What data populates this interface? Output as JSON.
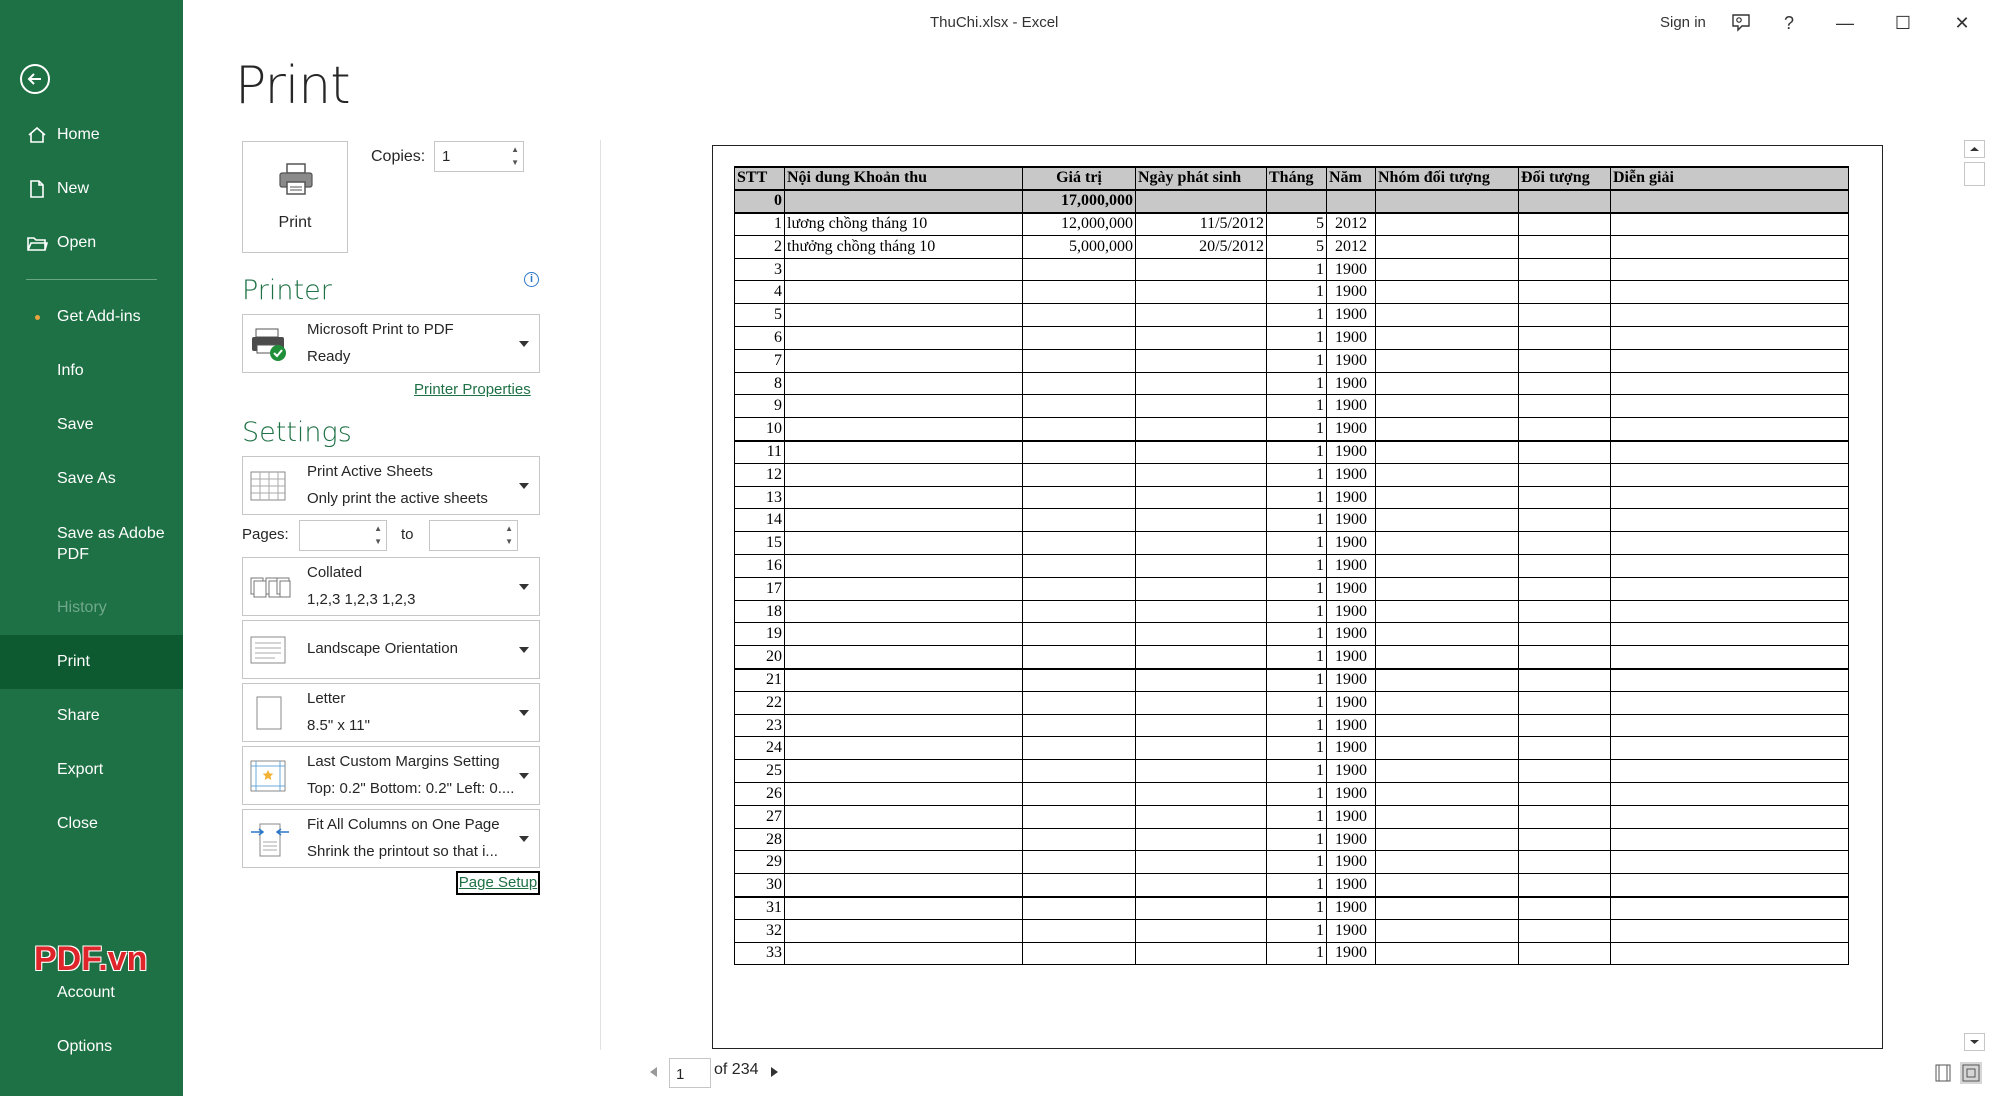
{
  "window": {
    "title": "ThuChi.xlsx  -  Excel",
    "sign_in": "Sign in",
    "help": "?",
    "minimize": "—",
    "maximize": "☐",
    "close": "✕"
  },
  "sidebar": {
    "items": [
      {
        "label": "Home",
        "icon": "home-icon"
      },
      {
        "label": "New",
        "icon": "new-document-icon"
      },
      {
        "label": "Open",
        "icon": "open-folder-icon"
      },
      {
        "label": "Get Add-ins"
      },
      {
        "label": "Info"
      },
      {
        "label": "Save"
      },
      {
        "label": "Save As"
      },
      {
        "label": "Save as Adobe PDF"
      },
      {
        "label": "History"
      },
      {
        "label": "Print"
      },
      {
        "label": "Share"
      },
      {
        "label": "Export"
      },
      {
        "label": "Close"
      },
      {
        "label": "Account"
      },
      {
        "label": "Options"
      }
    ],
    "watermark": "PDF.vn"
  },
  "print": {
    "title": "Print",
    "button_label": "Print",
    "copies_label": "Copies:",
    "copies_value": "1",
    "printer_heading": "Printer",
    "printer_name": "Microsoft Print to PDF",
    "printer_status": "Ready",
    "printer_properties": "Printer Properties",
    "settings_heading": "Settings",
    "settings": [
      {
        "line1": "Print Active Sheets",
        "line2": "Only print the active sheets"
      },
      {
        "line1": "Collated",
        "line2": "1,2,3    1,2,3    1,2,3"
      },
      {
        "line1": "Landscape Orientation",
        "line2": ""
      },
      {
        "line1": "Letter",
        "line2": "8.5\" x 11\""
      },
      {
        "line1": "Last Custom Margins Setting",
        "line2": "Top: 0.2\" Bottom: 0.2\" Left: 0...."
      },
      {
        "line1": "Fit All Columns on One Page",
        "line2": "Shrink the printout so that i..."
      }
    ],
    "pages_label": "Pages:",
    "to_label": "to",
    "page_setup": "Page Setup"
  },
  "preview": {
    "headers": [
      "STT",
      "Nội dung Khoản thu",
      "Giá trị",
      "Ngày phát sinh",
      "Tháng",
      "Năm",
      "Nhóm đối tượng",
      "Đối tượng",
      "Diễn giải"
    ],
    "total_row": [
      "0",
      "",
      "17,000,000",
      "",
      "",
      "",
      "",
      "",
      ""
    ],
    "rows": [
      [
        "1",
        "lương chồng tháng 10",
        "12,000,000",
        "11/5/2012",
        "5",
        "2012",
        "",
        "",
        ""
      ],
      [
        "2",
        "thưởng chồng tháng 10",
        "5,000,000",
        "20/5/2012",
        "5",
        "2012",
        "",
        "",
        ""
      ],
      [
        "3",
        "",
        "",
        "",
        "1",
        "1900",
        "",
        "",
        ""
      ],
      [
        "4",
        "",
        "",
        "",
        "1",
        "1900",
        "",
        "",
        ""
      ],
      [
        "5",
        "",
        "",
        "",
        "1",
        "1900",
        "",
        "",
        ""
      ],
      [
        "6",
        "",
        "",
        "",
        "1",
        "1900",
        "",
        "",
        ""
      ],
      [
        "7",
        "",
        "",
        "",
        "1",
        "1900",
        "",
        "",
        ""
      ],
      [
        "8",
        "",
        "",
        "",
        "1",
        "1900",
        "",
        "",
        ""
      ],
      [
        "9",
        "",
        "",
        "",
        "1",
        "1900",
        "",
        "",
        ""
      ],
      [
        "10",
        "",
        "",
        "",
        "1",
        "1900",
        "",
        "",
        ""
      ],
      [
        "11",
        "",
        "",
        "",
        "1",
        "1900",
        "",
        "",
        ""
      ],
      [
        "12",
        "",
        "",
        "",
        "1",
        "1900",
        "",
        "",
        ""
      ],
      [
        "13",
        "",
        "",
        "",
        "1",
        "1900",
        "",
        "",
        ""
      ],
      [
        "14",
        "",
        "",
        "",
        "1",
        "1900",
        "",
        "",
        ""
      ],
      [
        "15",
        "",
        "",
        "",
        "1",
        "1900",
        "",
        "",
        ""
      ],
      [
        "16",
        "",
        "",
        "",
        "1",
        "1900",
        "",
        "",
        ""
      ],
      [
        "17",
        "",
        "",
        "",
        "1",
        "1900",
        "",
        "",
        ""
      ],
      [
        "18",
        "",
        "",
        "",
        "1",
        "1900",
        "",
        "",
        ""
      ],
      [
        "19",
        "",
        "",
        "",
        "1",
        "1900",
        "",
        "",
        ""
      ],
      [
        "20",
        "",
        "",
        "",
        "1",
        "1900",
        "",
        "",
        ""
      ],
      [
        "21",
        "",
        "",
        "",
        "1",
        "1900",
        "",
        "",
        ""
      ],
      [
        "22",
        "",
        "",
        "",
        "1",
        "1900",
        "",
        "",
        ""
      ],
      [
        "23",
        "",
        "",
        "",
        "1",
        "1900",
        "",
        "",
        ""
      ],
      [
        "24",
        "",
        "",
        "",
        "1",
        "1900",
        "",
        "",
        ""
      ],
      [
        "25",
        "",
        "",
        "",
        "1",
        "1900",
        "",
        "",
        ""
      ],
      [
        "26",
        "",
        "",
        "",
        "1",
        "1900",
        "",
        "",
        ""
      ],
      [
        "27",
        "",
        "",
        "",
        "1",
        "1900",
        "",
        "",
        ""
      ],
      [
        "28",
        "",
        "",
        "",
        "1",
        "1900",
        "",
        "",
        ""
      ],
      [
        "29",
        "",
        "",
        "",
        "1",
        "1900",
        "",
        "",
        ""
      ],
      [
        "30",
        "",
        "",
        "",
        "1",
        "1900",
        "",
        "",
        ""
      ],
      [
        "31",
        "",
        "",
        "",
        "1",
        "1900",
        "",
        "",
        ""
      ],
      [
        "32",
        "",
        "",
        "",
        "1",
        "1900",
        "",
        "",
        ""
      ],
      [
        "33",
        "",
        "",
        "",
        "1",
        "1900",
        "",
        "",
        ""
      ]
    ],
    "current_page": "1",
    "page_total": "of 234"
  },
  "colors": {
    "sidebar": "#1e7145",
    "sidebar_selected": "#0e5a30",
    "accent": "#1e7145"
  }
}
